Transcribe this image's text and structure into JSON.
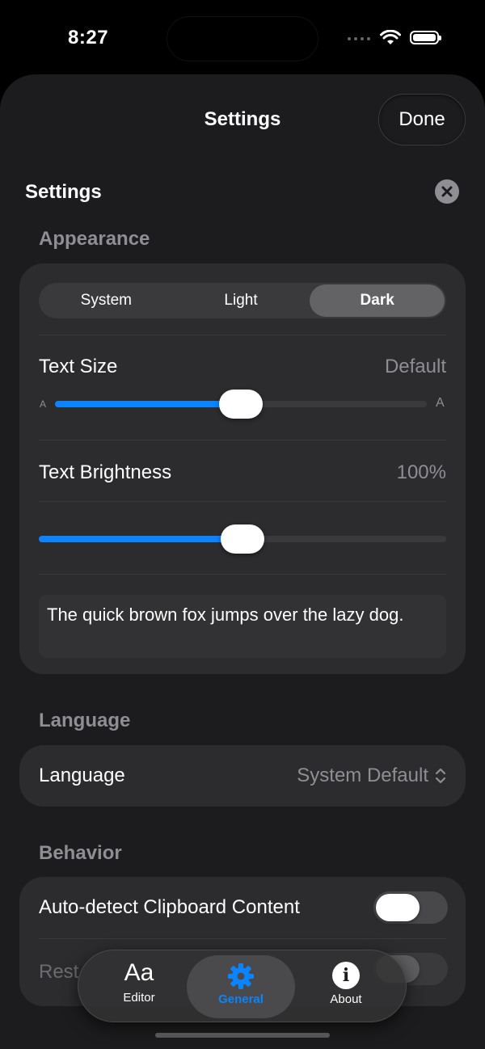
{
  "status": {
    "time": "8:27"
  },
  "nav": {
    "title": "Settings",
    "done_label": "Done"
  },
  "page": {
    "title": "Settings"
  },
  "appearance": {
    "header": "Appearance",
    "segments": [
      "System",
      "Light",
      "Dark"
    ],
    "selected": "Dark",
    "text_size_label": "Text Size",
    "text_size_value": "Default",
    "text_size_small_glyph": "A",
    "text_size_large_glyph": "A",
    "text_size_level": 0.5,
    "brightness_label": "Text Brightness",
    "brightness_value": "100%",
    "brightness_level": 0.5,
    "preview_text": "The quick brown fox jumps over the lazy dog."
  },
  "language": {
    "header": "Language",
    "label": "Language",
    "value": "System Default"
  },
  "behavior": {
    "header": "Behavior",
    "clipboard_label": "Auto-detect Clipboard Content",
    "clipboard_on": false,
    "restore_label": "Rest"
  },
  "tabbar": {
    "items": [
      {
        "glyph": "Aa",
        "label": "Editor"
      },
      {
        "glyph": "",
        "label": "General"
      },
      {
        "glyph": "i",
        "label": "About"
      }
    ],
    "active": "General"
  },
  "colors": {
    "accent": "#0a84ff",
    "background": "#1c1c1e",
    "card": "#2c2c2e",
    "secondary_text": "#8e8e93"
  }
}
